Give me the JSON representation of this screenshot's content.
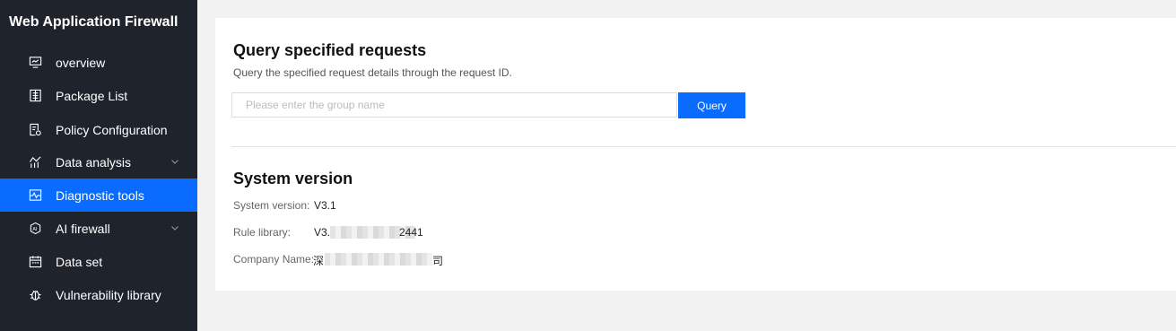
{
  "sidebar": {
    "brand": "Web Application Firewall",
    "items": [
      {
        "label": "overview",
        "icon": "monitor-icon"
      },
      {
        "label": "Package List",
        "icon": "package-list-icon"
      },
      {
        "label": "Policy Configuration",
        "icon": "policy-config-icon"
      },
      {
        "label": "Data analysis",
        "icon": "chart-icon",
        "expandable": true
      },
      {
        "label": "Diagnostic tools",
        "icon": "diagnostic-icon",
        "active": true
      },
      {
        "label": "AI firewall",
        "icon": "ai-icon",
        "expandable": true
      },
      {
        "label": "Data set",
        "icon": "calendar-icon"
      },
      {
        "label": "Vulnerability library",
        "icon": "bug-icon"
      }
    ]
  },
  "query": {
    "title": "Query specified requests",
    "description": "Query the specified request details through the request ID.",
    "placeholder": "Please enter the group name",
    "button": "Query"
  },
  "version": {
    "title": "System version",
    "system_version_label": "System version:",
    "system_version_value": "V3.1",
    "rule_library_label": "Rule library:",
    "rule_library_value": "V3.",
    "rule_library_suffix": "2441",
    "company_label": "Company Name:",
    "company_prefix": "深",
    "company_suffix": "司"
  },
  "colors": {
    "sidebar_bg": "#1f242c",
    "accent": "#0a6cff",
    "page_bg": "#f2f2f2"
  }
}
